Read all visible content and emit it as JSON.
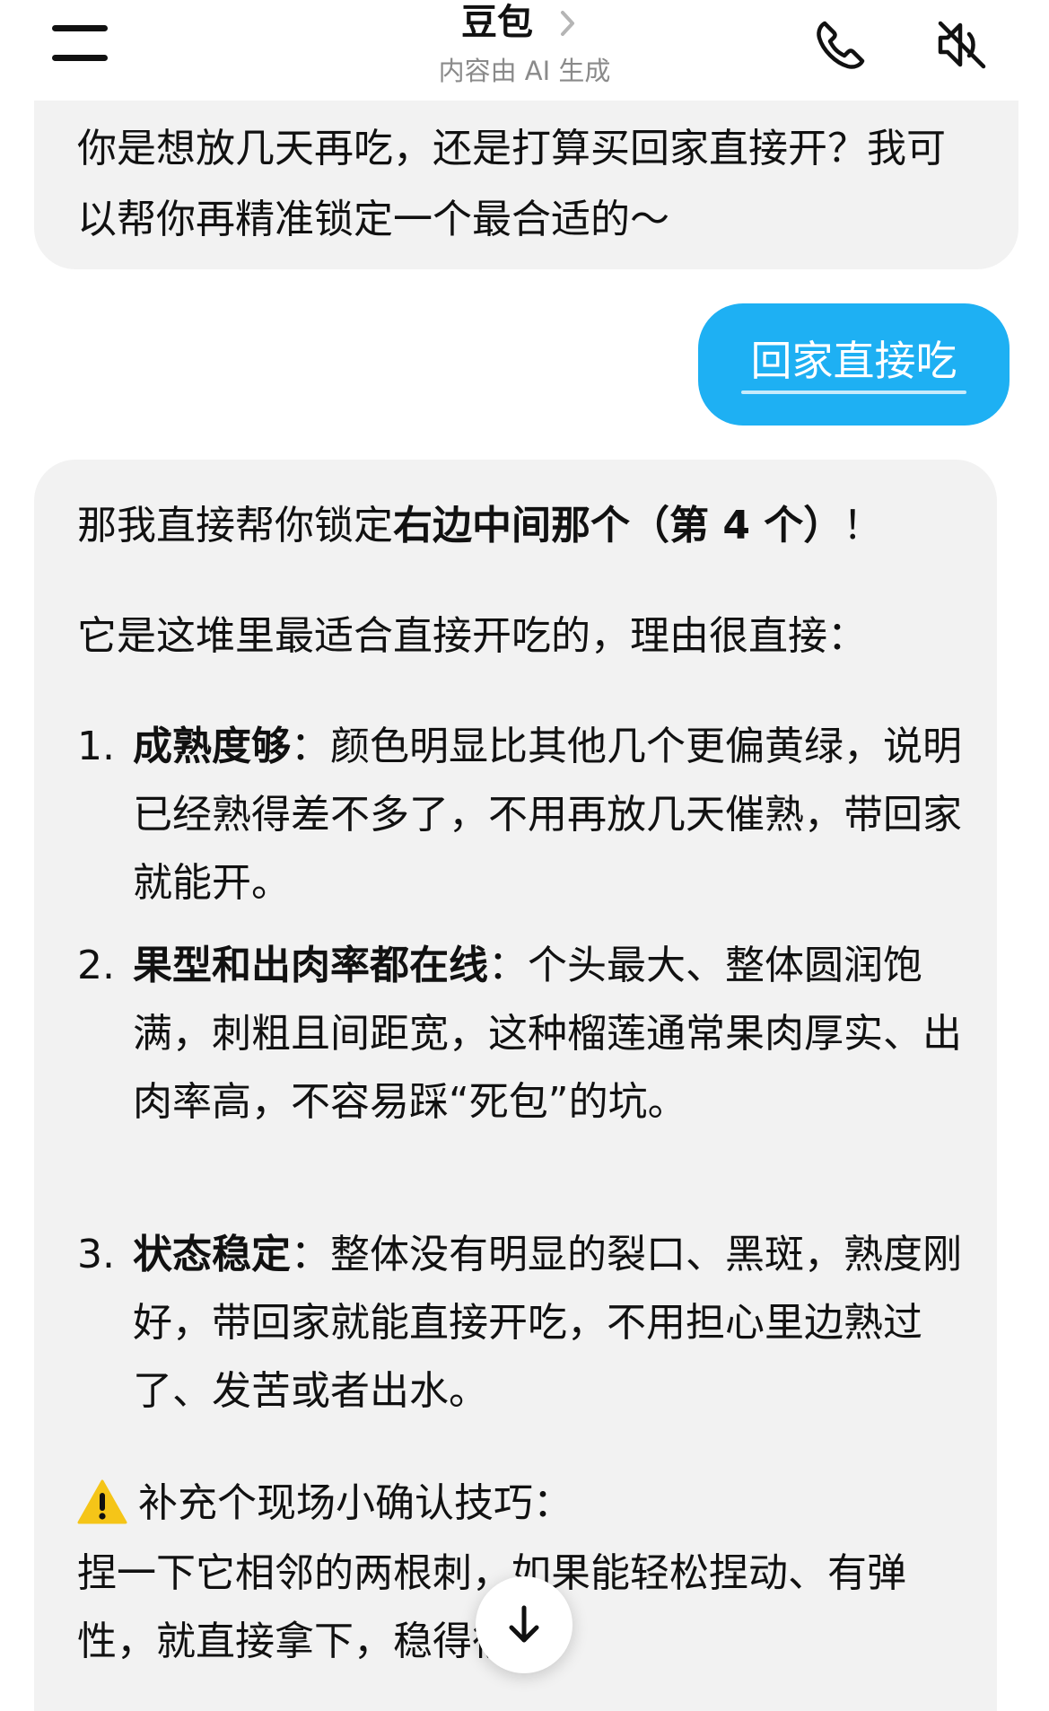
{
  "header": {
    "title": "豆包",
    "subtitle": "内容由 AI 生成",
    "icons": {
      "menu": "menu-icon",
      "chevron": "chevron-right-icon",
      "phone": "phone-icon",
      "mute": "speaker-muted-icon"
    }
  },
  "messages": {
    "ai_previous_tail": "你是想放几天再吃，还是打算买回家直接开？我可以帮你再精准锁定一个最合适的～",
    "user_reply": "回家直接吃",
    "ai_reply": {
      "intro_prefix": "那我直接帮你锁定",
      "intro_bold": "右边中间那个（第 4 个）",
      "intro_suffix": "！",
      "reason_lead": "它是这堆里最适合直接开吃的，理由很直接：",
      "reasons": [
        {
          "num": "1.",
          "bold": "成熟度够",
          "text": "：颜色明显比其他几个更偏黄绿，说明已经熟得差不多了，不用再放几天催熟，带回家就能开。"
        },
        {
          "num": "2.",
          "bold": "果型和出肉率都在线",
          "text": "：个头最大、整体圆润饱满，刺粗且间距宽，这种榴莲通常果肉厚实、出肉率高，不容易踩“死包”的坑。"
        },
        {
          "num": "3.",
          "bold": "状态稳定",
          "text": "：整体没有明显的裂口、黑斑，熟度刚好，带回家就能直接开吃，不用担心里边熟过了、发苦或者出水。"
        }
      ],
      "tip_title": "补充个现场小确认技巧：",
      "tip_body": "捏一下它相邻的两根刺，如果能轻松捏动、有弹性，就直接拿下，稳得很。"
    }
  },
  "controls": {
    "scroll_down_icon": "arrow-down-icon"
  },
  "colors": {
    "user_bubble": "#1eb0f3",
    "ai_bubble": "#f2f2f2",
    "subtitle": "#8a8a8a",
    "warning": "#f5c518"
  }
}
